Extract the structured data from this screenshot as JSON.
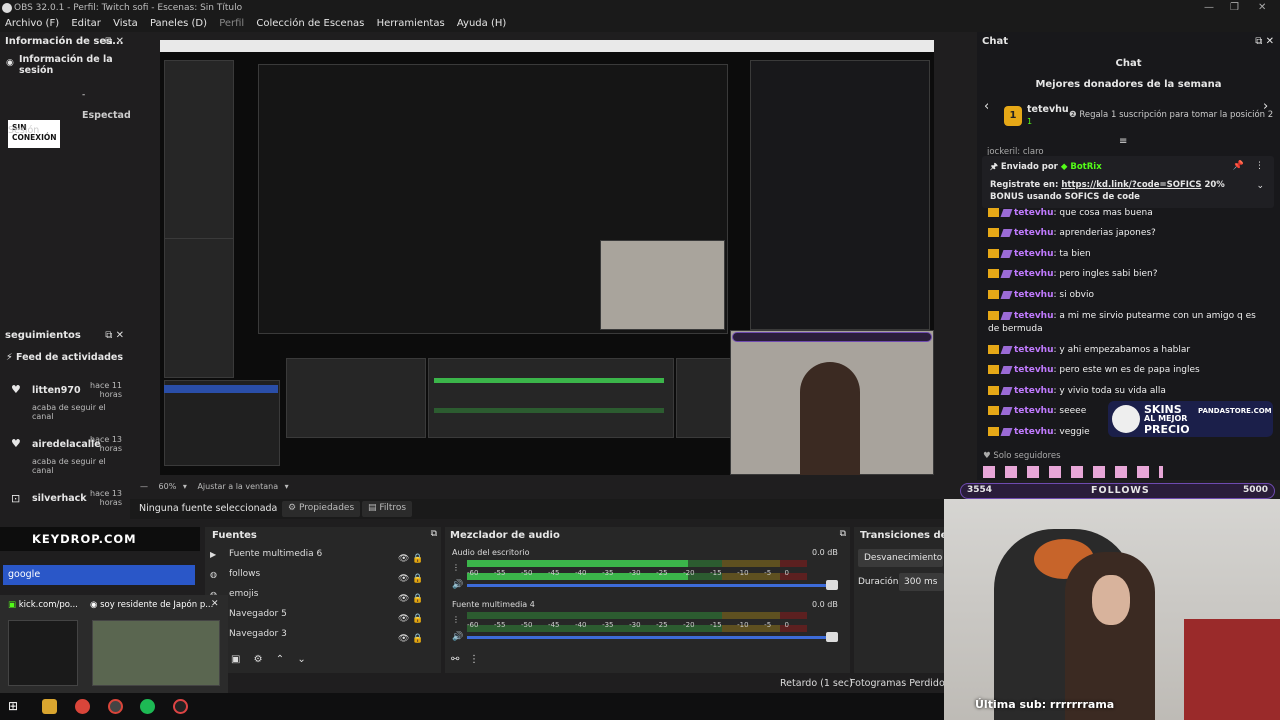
{
  "titlebar": {
    "title": "OBS 32.0.1 - Perfil: Twitch sofi - Escenas: Sin Título"
  },
  "menu": [
    "Archivo (F)",
    "Editar",
    "Vista",
    "Paneles (D)",
    "Perfil",
    "Colección de Escenas",
    "Herramientas",
    "Ayuda (H)"
  ],
  "session_dock": {
    "title": "Información de ses...",
    "heading": "Información de la sesión",
    "status": "SIN CONEXIÓN",
    "dash": "-",
    "expected": "Espectad",
    "session_label": "Sesión"
  },
  "follows_dock": {
    "title": "seguimientos",
    "feed": "Feed de actividades",
    "items": [
      {
        "user": "litten970",
        "time": "hace 11 horas",
        "desc": "acaba de seguir el canal"
      },
      {
        "user": "airedelacalle",
        "time": "hace 13 horas",
        "desc": "acaba de seguir el canal"
      },
      {
        "user": "silverhack",
        "time": "hace 13 horas",
        "desc": ""
      }
    ]
  },
  "preview_bar": {
    "zoom": "60%",
    "fit": "Ajustar a la ventana"
  },
  "props_bar": {
    "none": "Ninguna fuente seleccionada",
    "props": "Propiedades",
    "filters": "Filtros"
  },
  "overlay": {
    "keydrop": "KEYDROP.COM",
    "search_text": "google",
    "tab1": "kick.com/po...",
    "tab2": "soy residente de Japón p..."
  },
  "sources": {
    "title": "Fuentes",
    "items": [
      "Fuente multimedia 6",
      "follows",
      "emojis",
      "Navegador 5",
      "Navegador 3"
    ]
  },
  "mixer": {
    "title": "Mezclador de audio",
    "channels": [
      {
        "name": "Audio del escritorio",
        "db": "0.0 dB",
        "level": 0.65
      },
      {
        "name": "Fuente multimedia 4",
        "db": "0.0 dB",
        "level": 0
      }
    ],
    "scale": [
      "-60",
      "-55",
      "-50",
      "-45",
      "-40",
      "-35",
      "-30",
      "-25",
      "-20",
      "-15",
      "-10",
      "-5",
      "0"
    ]
  },
  "transitions": {
    "title": "Transiciones de esc",
    "type": "Desvanecimiento",
    "duration_label": "Duración",
    "duration": "300 ms"
  },
  "statusbar": {
    "delay": "Retardo (1 sec)",
    "dropped": "Fotogramas Perdidos 0"
  },
  "chat": {
    "dock_title": "Chat",
    "header": "Chat",
    "donors_title": "Mejores donadores de la semana",
    "top_donor": "tetevhu",
    "top_rank": "1",
    "top_count": "1",
    "rank2_hint": "Regala 1 suscripción para tomar la posición 2",
    "partial_line": "jockeril: claro",
    "pinned_by": "Enviado por",
    "pinned_bot": "BotRix",
    "pinned_text1": "Registrate en:",
    "pinned_link": "https://kd.link/?code=SOFICS",
    "pinned_text2": "20% BONUS usando SOFICS de code",
    "messages": [
      {
        "user": "tetevhu",
        "text": ": que cosa mas buena"
      },
      {
        "user": "tetevhu",
        "text": ": aprenderias japones?"
      },
      {
        "user": "tetevhu",
        "text": ": ta bien"
      },
      {
        "user": "tetevhu",
        "text": ": pero ingles sabi bien?"
      },
      {
        "user": "tetevhu",
        "text": ": si obvio"
      },
      {
        "user": "tetevhu",
        "text": ": a mi me sirvio putearme con un amigo q es de bermuda"
      },
      {
        "user": "tetevhu",
        "text": ": y ahi empezabamos a hablar"
      },
      {
        "user": "tetevhu",
        "text": ": pero este wn es de papa ingles"
      },
      {
        "user": "tetevhu",
        "text": ": y vivio toda su vida alla"
      },
      {
        "user": "tetevhu",
        "text": ": seeee"
      },
      {
        "user": "tetevhu",
        "text": ": veggie"
      }
    ],
    "followers_only": "Solo seguidores"
  },
  "skins_banner": {
    "line1": "SKINS",
    "line2": "AL MEJOR",
    "line3": "PRECIO",
    "site": "PANDASTORE.COM"
  },
  "follows_bar": {
    "left": "3554",
    "label": "FOLLOWS",
    "right": "5000"
  },
  "webcam": {
    "sub_label": "Última sub: rrrrrrrama"
  },
  "colors": {
    "accent_green": "#3bb54a",
    "chat_user": "#c17bff",
    "follows_purple": "#6f4bb0",
    "kick_green": "#53fc18"
  }
}
